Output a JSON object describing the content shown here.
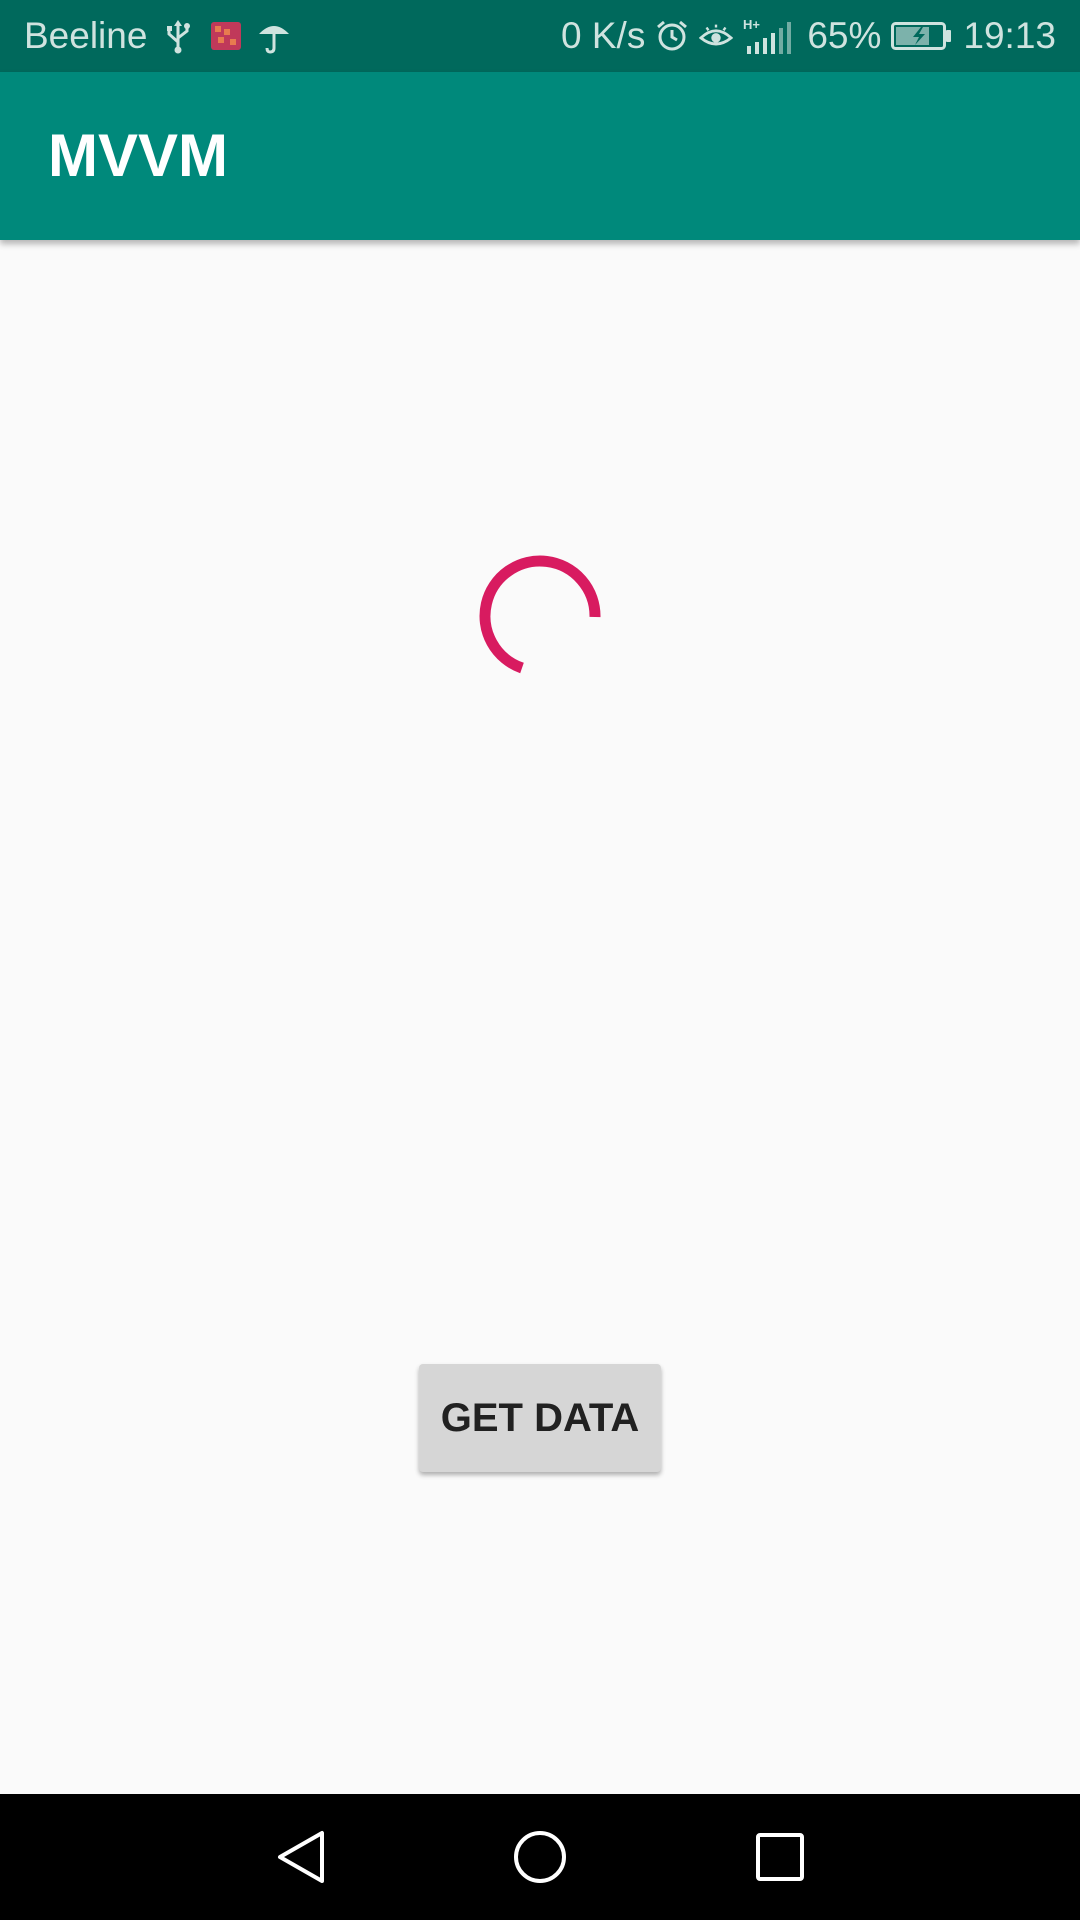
{
  "status_bar": {
    "carrier": "Beeline",
    "net_speed": "0 K/s",
    "network_type": "H+",
    "battery_percent": "65%",
    "time": "19:13",
    "left_icons": [
      "usb-icon",
      "app-notification-icon",
      "umbrella-icon"
    ],
    "right_icons": [
      "alarm-icon",
      "eye-comfort-icon",
      "signal-icon",
      "battery-charging-icon"
    ],
    "background_color": "#00695c"
  },
  "app_bar": {
    "title": "MVVM",
    "background_color": "#00897b"
  },
  "main": {
    "progress": {
      "type": "indeterminate-circular",
      "color": "#d81b60"
    },
    "get_data_button": {
      "label": "GET DATA"
    }
  },
  "nav_bar": {
    "buttons": [
      "back-icon",
      "home-icon",
      "recents-icon"
    ]
  }
}
